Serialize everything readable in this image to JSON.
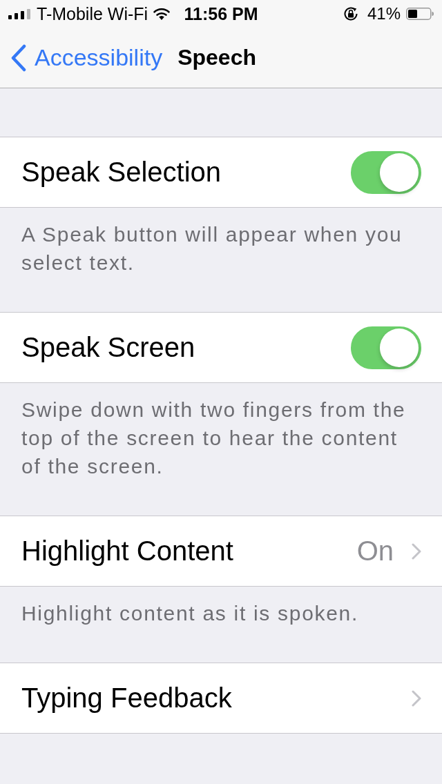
{
  "status_bar": {
    "carrier": "T-Mobile Wi-Fi",
    "time": "11:56 PM",
    "battery": "41%"
  },
  "nav": {
    "back": "Accessibility",
    "title": "Speech"
  },
  "groups": [
    {
      "rows": [
        {
          "kind": "toggle",
          "label": "Speak Selection",
          "on": true
        }
      ],
      "footer": "A Speak button will appear when you select text."
    },
    {
      "rows": [
        {
          "kind": "toggle",
          "label": "Speak Screen",
          "on": true
        }
      ],
      "footer": "Swipe down with two fingers from the top of the screen to hear the content of the screen."
    },
    {
      "rows": [
        {
          "kind": "disclosure",
          "label": "Highlight Content",
          "value": "On"
        }
      ],
      "footer": "Highlight content as it is spoken."
    },
    {
      "rows": [
        {
          "kind": "disclosure",
          "label": "Typing Feedback"
        }
      ]
    }
  ]
}
